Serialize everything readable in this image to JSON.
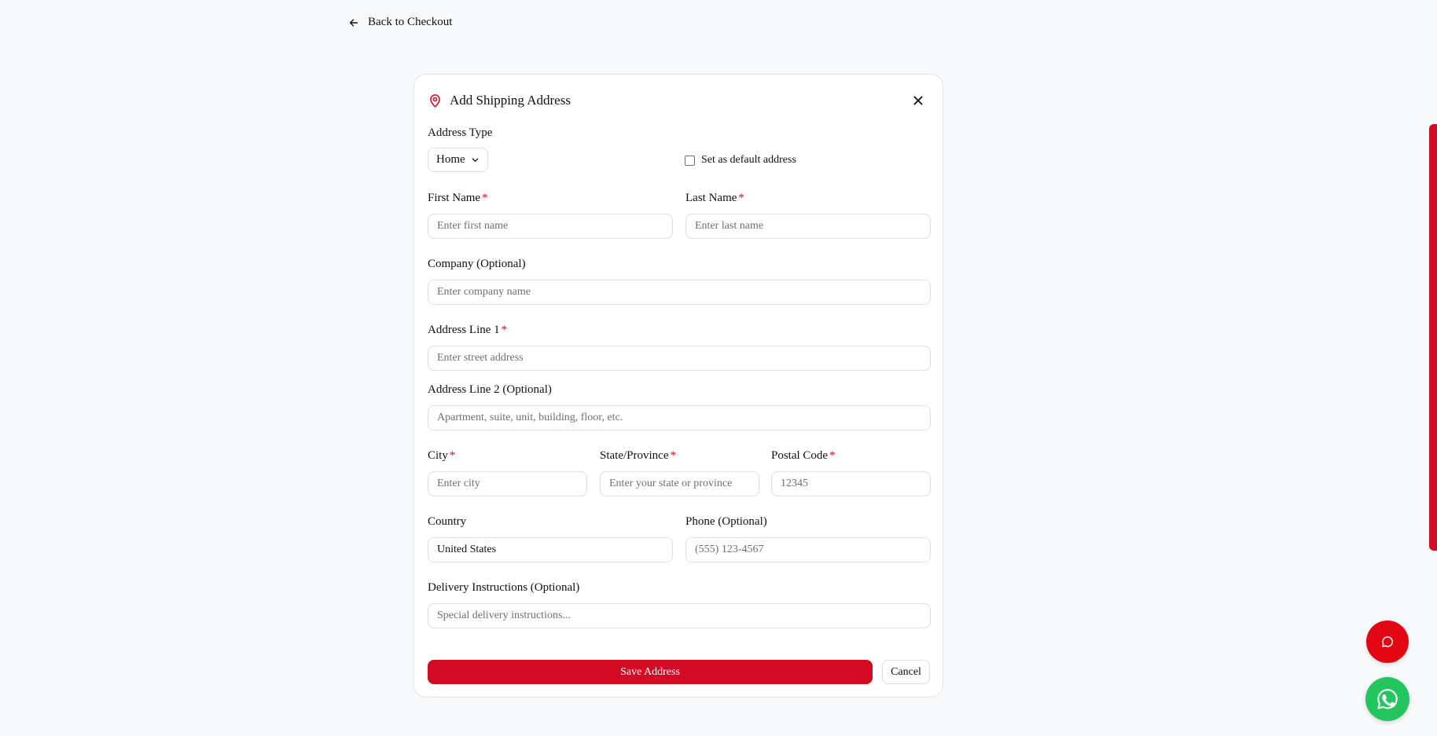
{
  "nav": {
    "back_label": "Back to Checkout"
  },
  "card": {
    "title": "Add Shipping Address"
  },
  "address_type": {
    "label": "Address Type",
    "selected": "Home"
  },
  "default_checkbox": {
    "label": "Set as default address",
    "checked": false
  },
  "first_name": {
    "label": "First Name",
    "required": "*",
    "placeholder": "Enter first name",
    "value": ""
  },
  "last_name": {
    "label": "Last Name",
    "required": "*",
    "placeholder": "Enter last name",
    "value": ""
  },
  "company": {
    "label": "Company (Optional)",
    "placeholder": "Enter company name",
    "value": ""
  },
  "address_line1": {
    "label": "Address Line 1",
    "required": "*",
    "placeholder": "Enter street address",
    "value": ""
  },
  "address_line2": {
    "label": "Address Line 2 (Optional)",
    "placeholder": "Apartment, suite, unit, building, floor, etc.",
    "value": ""
  },
  "city": {
    "label": "City",
    "required": "*",
    "placeholder": "Enter city",
    "value": ""
  },
  "state": {
    "label": "State/Province",
    "required": "*",
    "placeholder": "Enter your state or province",
    "value": ""
  },
  "postal_code": {
    "label": "Postal Code",
    "required": "*",
    "placeholder": "12345",
    "value": ""
  },
  "country": {
    "label": "Country",
    "value": "United States"
  },
  "phone": {
    "label": "Phone (Optional)",
    "placeholder": "(555) 123-4567",
    "value": ""
  },
  "delivery": {
    "label": "Delivery Instructions (Optional)",
    "placeholder": "Special delivery instructions...",
    "value": ""
  },
  "actions": {
    "save_label": "Save Address",
    "cancel_label": "Cancel"
  },
  "icons": {
    "back": "arrow-left-icon",
    "title": "map-pin-icon",
    "close": "close-icon",
    "select": "chevron-down-icon",
    "chat": "chat-bubble-icon",
    "whatsapp": "whatsapp-icon"
  },
  "colors": {
    "accent": "#d30a24",
    "chat_button": "#e20613",
    "whatsapp_button": "#22c55e",
    "background": "#f8f9fb"
  }
}
